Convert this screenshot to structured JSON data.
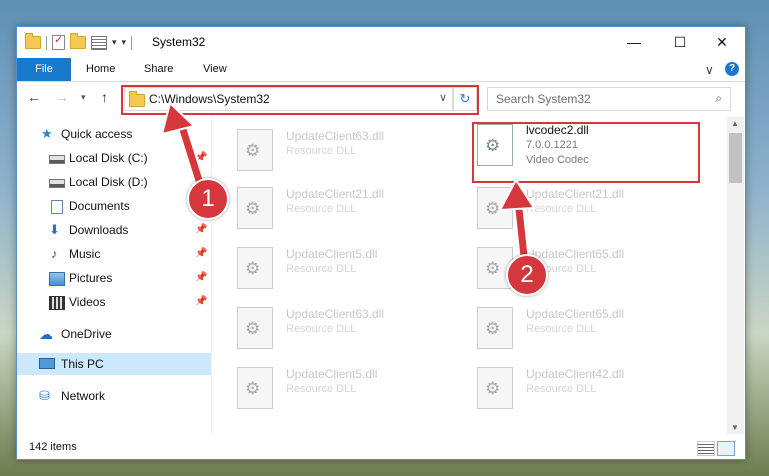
{
  "window": {
    "title": "System32",
    "qat_dropdown": "▾",
    "qat_customize": "▾",
    "controls": {
      "minimize": "—",
      "maximize": "☐",
      "close": "✕"
    }
  },
  "ribbon": {
    "tabs": [
      "File",
      "Home",
      "Share",
      "View"
    ],
    "expand_icon": "∨",
    "help": "?"
  },
  "nav": {
    "back": "←",
    "forward": "→",
    "recent": "▾",
    "up": "↑",
    "address": "C:\\Windows\\System32",
    "address_chevron": "∨",
    "refresh": "↻",
    "search_placeholder": "Search System32",
    "search_icon": "⌕"
  },
  "sidebar": {
    "items": [
      {
        "label": "Quick access",
        "icon": "star-icon",
        "pinned": false
      },
      {
        "label": "Local Disk (C:)",
        "icon": "drive-icon",
        "pinned": true
      },
      {
        "label": "Local Disk (D:)",
        "icon": "drive-icon",
        "pinned": false
      },
      {
        "label": "Documents",
        "icon": "document-icon",
        "pinned": false
      },
      {
        "label": "Downloads",
        "icon": "download-icon",
        "pinned": true
      },
      {
        "label": "Music",
        "icon": "music-icon",
        "pinned": true
      },
      {
        "label": "Pictures",
        "icon": "pictures-icon",
        "pinned": true
      },
      {
        "label": "Videos",
        "icon": "videos-icon",
        "pinned": true
      },
      {
        "label": "OneDrive",
        "icon": "cloud-icon",
        "pinned": false
      },
      {
        "label": "This PC",
        "icon": "computer-icon",
        "pinned": false,
        "selected": true
      },
      {
        "label": "Network",
        "icon": "network-icon",
        "pinned": false
      }
    ],
    "pin_glyph": "📌"
  },
  "files": [
    {
      "name": "UpdateClient63.dll",
      "desc": "Resource DLL"
    },
    {
      "name": "lvcodec2.dll",
      "version": "7.0.0.1221",
      "desc": "Video Codec",
      "highlighted": true
    },
    {
      "name": "UpdateClient21.dll",
      "desc": "Resource DLL"
    },
    {
      "name": "UpdateClient21.dll",
      "desc": "Resource DLL"
    },
    {
      "name": "UpdateClient5.dll",
      "desc": "Resource DLL"
    },
    {
      "name": "UpdateClient65.dll",
      "desc": "Resource DLL"
    },
    {
      "name": "UpdateClient63.dll",
      "desc": "Resource DLL"
    },
    {
      "name": "UpdateClient65.dll",
      "desc": "Resource DLL"
    },
    {
      "name": "UpdateClient5.dll",
      "desc": "Resource DLL"
    },
    {
      "name": "UpdateClient42.dll",
      "desc": "Resource DLL"
    }
  ],
  "status": {
    "item_count": "142 items"
  },
  "annotations": {
    "step1": "1",
    "step2": "2",
    "color": "#d6373d"
  }
}
